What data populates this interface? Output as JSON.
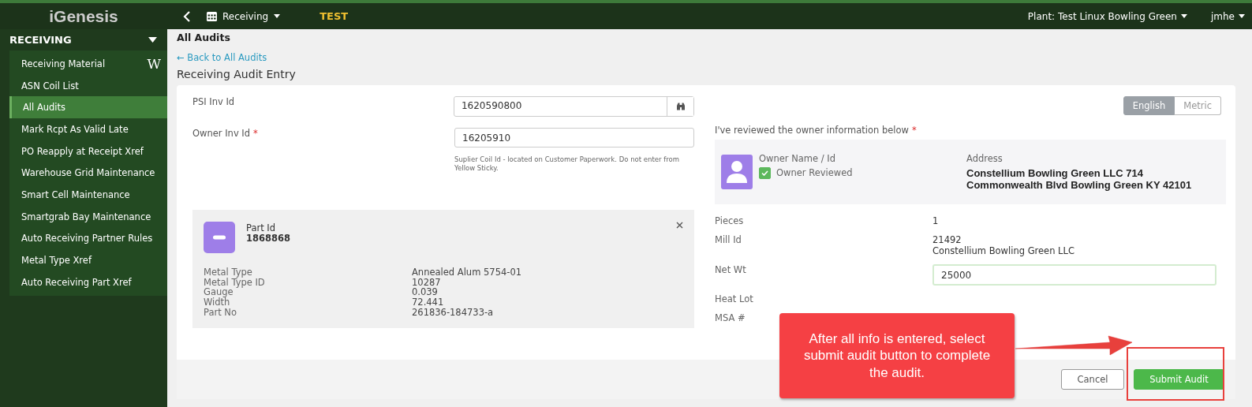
{
  "topbar": {
    "logo": "iGenesis",
    "module": "Receiving",
    "environment": "TEST",
    "plant": "Plant: Test Linux Bowling Green",
    "user": "jmhe"
  },
  "sidebar": {
    "section": "RECEIVING",
    "expanded": true,
    "items": [
      {
        "label": "Receiving Material",
        "selected": false,
        "badge": "W"
      },
      {
        "label": "ASN Coil List",
        "selected": false
      },
      {
        "label": "All Audits",
        "selected": true
      },
      {
        "label": "Mark Rcpt As Valid Late",
        "selected": false
      },
      {
        "label": "PO Reapply at Receipt Xref",
        "selected": false
      },
      {
        "label": "Warehouse Grid Maintenance",
        "selected": false
      },
      {
        "label": "Smart Cell Maintenance",
        "selected": false
      },
      {
        "label": "Smartgrab Bay Maintenance",
        "selected": false
      },
      {
        "label": "Auto Receiving Partner Rules",
        "selected": false
      },
      {
        "label": "Metal Type Xref",
        "selected": false
      },
      {
        "label": "Auto Receiving Part Xref",
        "selected": false
      }
    ]
  },
  "page": {
    "title": "All Audits",
    "back_link": "← Back to All Audits",
    "heading": "Receiving Audit Entry"
  },
  "form": {
    "psi_inv_id": {
      "label": "PSI Inv Id",
      "value": "1620590800"
    },
    "owner_inv_id": {
      "label": "Owner Inv Id",
      "required": true,
      "required_mark": "*",
      "value": "16205910",
      "hint": "Suplier Coil Id - located on Customer Paperwork. Do not enter from Yellow Sticky."
    },
    "part": {
      "label": "Part Id",
      "id": "1868868",
      "details": [
        {
          "label": "Metal Type",
          "value": "Annealed Alum 5754-01"
        },
        {
          "label": "Metal Type ID",
          "value": "10287"
        },
        {
          "label": "Gauge",
          "value": "0.039"
        },
        {
          "label": "Width",
          "value": "72.441"
        },
        {
          "label": "Part No",
          "value": "261836-184733-a"
        }
      ]
    },
    "units": [
      {
        "label": "English",
        "selected": true
      },
      {
        "label": "Metric",
        "selected": false
      }
    ],
    "owner_review": {
      "label": "I've reviewed the owner information below",
      "required": true,
      "required_mark": "*",
      "name_label": "Owner Name / Id",
      "checkbox_label": "Owner Reviewed",
      "checked": true,
      "address_label": "Address",
      "address": "Constellium Bowling Green LLC 714 Commonwealth Blvd Bowling Green KY 42101"
    },
    "fields": [
      {
        "kind": "text",
        "label": "Pieces",
        "lines": [
          "1"
        ]
      },
      {
        "kind": "text",
        "label": "Mill Id",
        "lines": [
          "21492",
          "Constellium Bowling Green LLC"
        ]
      },
      {
        "kind": "input",
        "label": "Net Wt",
        "value": "25000"
      },
      {
        "kind": "text",
        "label": "Heat Lot"
      },
      {
        "kind": "text",
        "label": "MSA #"
      }
    ]
  },
  "buttons": [
    {
      "label": "Cancel",
      "kind": "secondary"
    },
    {
      "label": "Submit Audit",
      "kind": "primary"
    }
  ],
  "annotation": {
    "text": "After all info is entered, select submit audit button to complete the audit."
  }
}
